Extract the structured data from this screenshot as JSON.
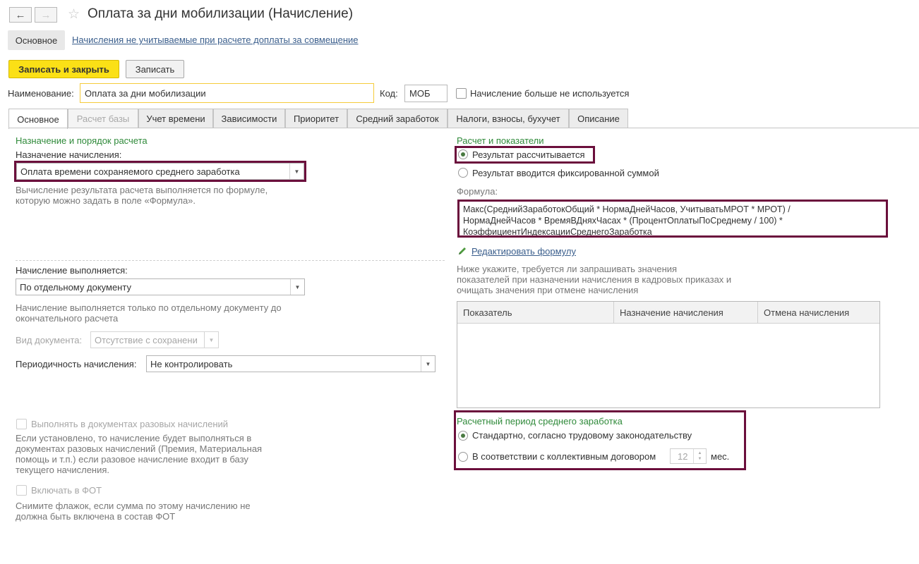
{
  "window": {
    "title": "Оплата за дни мобилизации (Начисление)"
  },
  "nav": {
    "back_icon": "←",
    "forward_icon": "→",
    "favorite_icon": "☆"
  },
  "sections": {
    "main_label": "Основное",
    "link_label": "Начисления не учитываемые при расчете доплаты за совмещение"
  },
  "toolbar": {
    "save_close_label": "Записать и закрыть",
    "save_label": "Записать"
  },
  "header": {
    "name_label": "Наименование:",
    "name_value": "Оплата за дни мобилизации",
    "code_label": "Код:",
    "code_value": "МОБ",
    "unused_label": "Начисление больше не используется"
  },
  "tabs": [
    {
      "label": "Основное"
    },
    {
      "label": "Расчет базы"
    },
    {
      "label": "Учет времени"
    },
    {
      "label": "Зависимости"
    },
    {
      "label": "Приоритет"
    },
    {
      "label": "Средний заработок"
    },
    {
      "label": "Налоги, взносы, бухучет"
    },
    {
      "label": "Описание"
    }
  ],
  "left": {
    "purpose_group": "Назначение и порядок расчета",
    "purpose_label": "Назначение начисления:",
    "purpose_value": "Оплата времени сохраняемого среднего заработка",
    "purpose_hint_1": "Вычисление результата расчета выполняется по формуле,",
    "purpose_hint_2": "которую можно задать в поле «Формула».",
    "executed_label": "Начисление выполняется:",
    "executed_value": "По отдельному документу",
    "executed_hint_1": "Начисление выполняется только по отдельному документу до",
    "executed_hint_2": "окончательного расчета",
    "doc_type_label": "Вид документа:",
    "doc_type_value": "Отсутствие с сохранени",
    "period_label": "Периодичность начисления:",
    "period_value": "Не контролировать",
    "one_time_label": "Выполнять в документах разовых начислений",
    "one_time_hint_1": "Если установлено, то начисление будет выполняться в",
    "one_time_hint_2": "документах разовых начислений (Премия, Материальная",
    "one_time_hint_3": "помощь и т.п.) если разовое начисление входит в базу",
    "one_time_hint_4": "текущего начисления.",
    "fot_label": "Включать в ФОТ",
    "fot_hint_1": "Снимите флажок, если сумма по этому начислению не",
    "fot_hint_2": "должна быть включена в состав ФОТ"
  },
  "right": {
    "calc_group": "Расчет и показатели",
    "radio_calculated": "Результат рассчитывается",
    "radio_fixed": "Результат вводится фиксированной суммой",
    "formula_label": "Формула:",
    "formula_line_1": "Макс(СреднийЗаработокОбщий * НормаДнейЧасов, УчитыватьМРОТ * МРОТ) /",
    "formula_line_2": "НормаДнейЧасов * ВремяВДняхЧасах * (ПроцентОплатыПоСреднему / 100) *",
    "formula_line_3": "КоэффициентИндексацииСреднегоЗаработка",
    "edit_formula_link": "Редактировать формулу",
    "indicators_hint_1": "Ниже укажите, требуется ли запрашивать значения",
    "indicators_hint_2": "показателей при назначении начисления в кадровых приказах и",
    "indicators_hint_3": "очищать значения при отмене начисления",
    "table_headers": [
      "Показатель",
      "Назначение начисления",
      "Отмена начисления"
    ],
    "avg_period_group": "Расчетный период среднего заработка",
    "radio_standard": "Стандартно, согласно трудовому законодательству",
    "radio_collective": "В соответствии с коллективным договором",
    "months_value": "12",
    "months_unit": "мес."
  },
  "colors": {
    "accent_yellow": "#fbe016",
    "highlight_frame": "#6b0f3c",
    "group_green": "#2f8a3a",
    "link_blue": "#3a5e8c"
  }
}
